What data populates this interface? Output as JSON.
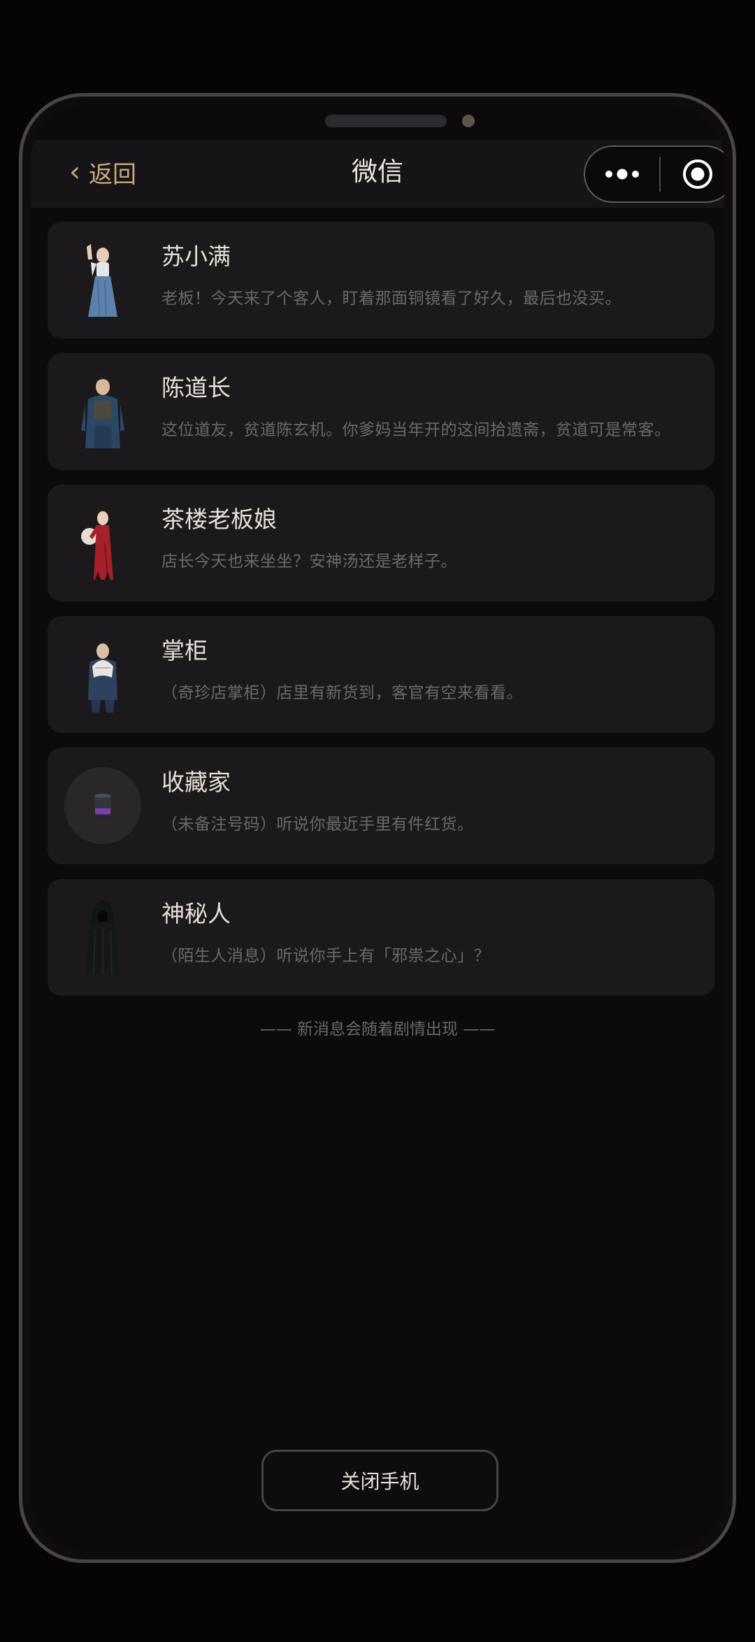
{
  "navbar": {
    "back_label": "返回",
    "title": "微信"
  },
  "chats": [
    {
      "name": "苏小满",
      "preview": "老板！今天来了个客人，盯着那面铜镜看了好久，最后也没买。",
      "avatar": "girl-blue-skirt-avatar"
    },
    {
      "name": "陈道长",
      "preview": "这位道友，贫道陈玄机。你爹妈当年开的这间拾遗斋，贫道可是常客。",
      "avatar": "taoist-man-avatar"
    },
    {
      "name": "茶楼老板娘",
      "preview": "店长今天也来坐坐？安神汤还是老样子。",
      "avatar": "lady-red-qipao-avatar"
    },
    {
      "name": "掌柜",
      "preview": "（奇珍店掌柜）店里有新货到，客官有空来看看。",
      "avatar": "shopkeeper-fan-avatar"
    },
    {
      "name": "收藏家",
      "preview": "（未备注号码）听说你最近手里有件红货。",
      "avatar": "top-hat-avatar"
    },
    {
      "name": "神秘人",
      "preview": "（陌生人消息）听说你手上有「邪祟之心」？",
      "avatar": "hooded-figure-avatar"
    }
  ],
  "footer_note": "—— 新消息会随着剧情出现 ——",
  "close_button_label": "关闭手机",
  "colors": {
    "accent_gold": "#c9a87c",
    "card_bg": "#1b191c",
    "screen_bg": "#0c0a0d"
  }
}
